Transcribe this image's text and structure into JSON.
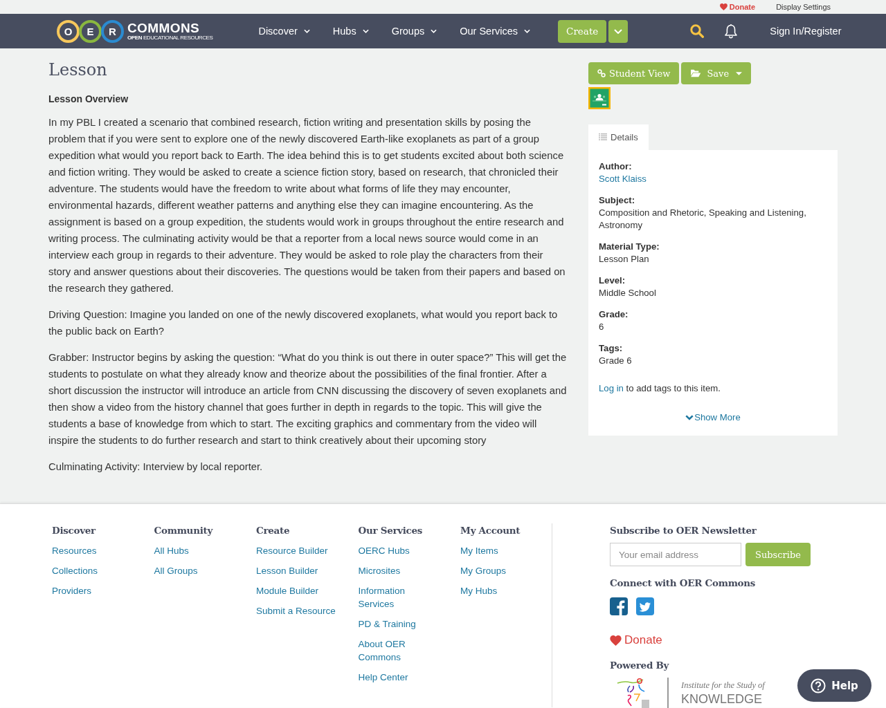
{
  "top_bar": {
    "links": [
      {
        "kind": "donate",
        "label": "Donate"
      },
      {
        "kind": "plain",
        "label": "Display Settings"
      }
    ]
  },
  "nav": {
    "logo": {
      "letters": [
        {
          "letter": "O",
          "color": "#f7c85c"
        },
        {
          "letter": "E",
          "color": "#8ab73f"
        },
        {
          "letter": "R",
          "color": "#2b8bd0"
        }
      ],
      "wordmark": "COMMONS",
      "tagline": "**OPEN** EDUCATIONAL RESOURCES"
    },
    "menu": [
      {
        "label": "Discover"
      },
      {
        "label": "Hubs"
      },
      {
        "label": "Groups"
      },
      {
        "label": "Our Services"
      }
    ],
    "create_button": "Create",
    "sign_in": "Sign In/Register"
  },
  "lesson": {
    "title": "Lesson",
    "heading": "Lesson Overview",
    "paragraphs": [
      "In my PBL I created a scenario that combined research, fiction writing and presentation skills by posing the problem that if you were sent to explore one of the newly discovered Earth-like exoplanets as part of a group expedition what would you report back to Earth. The idea behind this is to get students excited about both science and fiction writing. They would be asked to create a science fiction story, based on research, that chronicled their adventure. The students would have the freedom to write about what forms of life they may encounter, environmental hazards, different weather patterns and anything else they can imagine encountering. As the assignment is based on a group expedition, the students would work in groups throughout the entire research and writing process. The culminating activity would be that a reporter from a local news source would come in an interview each group in regards to their adventure. They would be asked to role play the characters from their story and answer questions about their discoveries. The questions would be taken from their papers and based on the research they gathered.",
      "Driving Question: Imagine you landed on one of the newly discovered exoplanets, what would you report back to the public back on Earth?",
      "Grabber: Instructor begins by asking the question: “What do you think is out there in outer space?” This will get the students to postulate on what they already know and theorize about the possibilities of the final frontier. After a short discussion the instructor will introduce an article from CNN discussing the discovery of seven exoplanets and then show a video from the history channel that goes further in depth in regards to the topic. This will give the students a base of knowledge from which to start. The exciting graphics and commentary from the video will inspire the students to do further research and start to think creatively about their upcoming story",
      "Culminating Activity: Interview by local reporter."
    ]
  },
  "actions": [
    {
      "kind": "student_view",
      "label": "Student View"
    },
    {
      "kind": "save",
      "label": "Save"
    }
  ],
  "tabs": [
    {
      "label": "Details",
      "selected": true
    }
  ],
  "details": {
    "fields": [
      {
        "label": "Author:",
        "value": "Scott Klaiss",
        "kind": "link"
      },
      {
        "label": "Subject:",
        "value": "Composition and Rhetoric, Speaking and Listening, Astronomy",
        "kind": "text"
      },
      {
        "label": "Material Type:",
        "value": "Lesson Plan",
        "kind": "text"
      },
      {
        "label": "Level:",
        "value": "Middle School",
        "kind": "text"
      },
      {
        "label": "Grade:",
        "value": "6",
        "kind": "text"
      },
      {
        "label": "Tags:",
        "value": "Grade 6",
        "kind": "text"
      }
    ],
    "tags_note": {
      "link": "Log in",
      "text": "to add tags to this item."
    },
    "show_more": "Show More"
  },
  "footer": {
    "columns": [
      {
        "heading": "Discover",
        "links": [
          "Resources",
          "Collections",
          "Providers"
        ]
      },
      {
        "heading": "Community",
        "links": [
          "All Hubs",
          "All Groups"
        ]
      },
      {
        "heading": "Create",
        "links": [
          "Resource Builder",
          "Lesson Builder",
          "Module Builder",
          "Submit a Resource"
        ]
      },
      {
        "heading": "Our Services",
        "links": [
          "OERC Hubs",
          "Microsites",
          "Information Services",
          "PD & Training",
          "About OER Commons",
          "Help Center"
        ]
      },
      {
        "heading": "My Account",
        "links": [
          "My Items",
          "My Groups",
          "My Hubs"
        ]
      }
    ],
    "newsletter": {
      "heading": "Subscribe to OER Newsletter",
      "placeholder": "Your email address",
      "button": "Subscribe"
    },
    "connect_heading": "Connect with OER Commons",
    "donate": "Donate",
    "powered_by": "Powered By",
    "partner": {
      "tagline": "Institute for the Study of",
      "wordmark": "KNOWLEDGE"
    }
  },
  "help_button": "Help"
}
